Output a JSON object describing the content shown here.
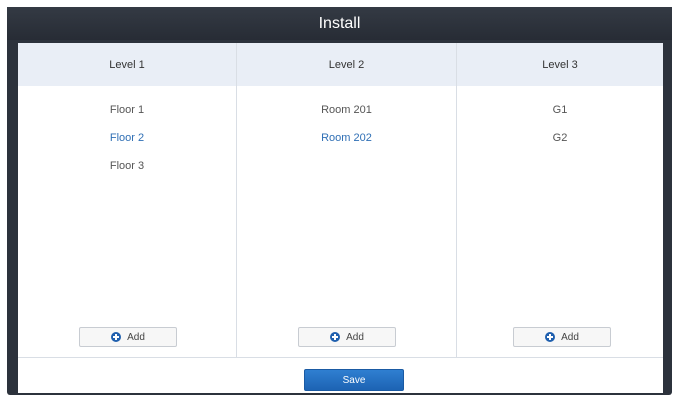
{
  "window": {
    "title": "Install"
  },
  "columns": [
    {
      "header": "Level 1",
      "items": [
        "Floor 1",
        "Floor 2",
        "Floor 3"
      ],
      "selected_index": 1,
      "add_label": "Add"
    },
    {
      "header": "Level 2",
      "items": [
        "Room 201",
        "Room 202"
      ],
      "selected_index": 1,
      "add_label": "Add"
    },
    {
      "header": "Level 3",
      "items": [
        "G1",
        "G2"
      ],
      "selected_index": -1,
      "add_label": "Add"
    }
  ],
  "footer": {
    "save_label": "Save"
  },
  "colors": {
    "accent": "#1f5fae",
    "selected_text": "#2f6fb5",
    "header_bg": "#e9eef6",
    "title_bar": "#2c323c"
  },
  "icons": {
    "add": "plus-circle-icon"
  }
}
